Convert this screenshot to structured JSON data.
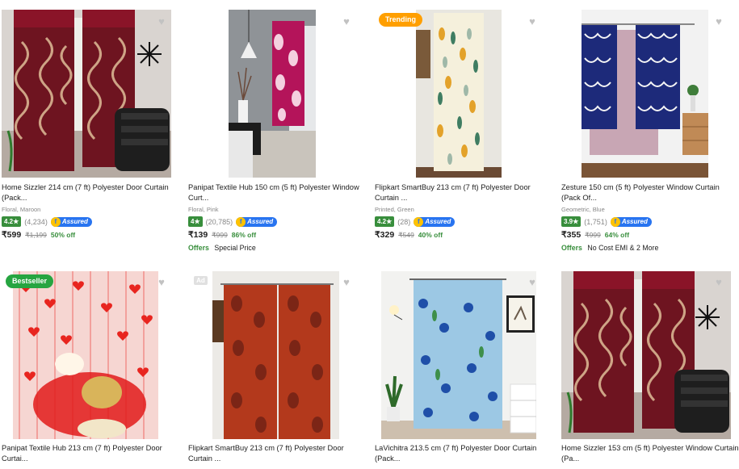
{
  "products": [
    {
      "title": "Home Sizzler 214 cm (7 ft) Polyester Door Curtain (Pack...",
      "subtitle": "Floral, Maroon",
      "rating": "4.2★",
      "reviews": "(4,234)",
      "assured": "Assured",
      "price": "₹599",
      "mrp": "₹1,199",
      "discount": "50% off",
      "offers_label": "",
      "offers_text": ""
    },
    {
      "title": "Panipat Textile Hub 150 cm (5 ft) Polyester Window Curt...",
      "subtitle": "Floral, Pink",
      "rating": "4★",
      "reviews": "(20,785)",
      "assured": "Assured",
      "price": "₹139",
      "mrp": "₹999",
      "discount": "86% off",
      "offers_label": "Offers",
      "offers_text": "Special Price"
    },
    {
      "title": "Flipkart SmartBuy 213 cm (7 ft) Polyester Door Curtain ...",
      "subtitle": "Printed, Green",
      "rating": "4.2★",
      "reviews": "(28)",
      "assured": "Assured",
      "price": "₹329",
      "mrp": "₹549",
      "discount": "40% off",
      "offers_label": "",
      "offers_text": "",
      "tag": "Trending"
    },
    {
      "title": "Zesture 150 cm (5 ft) Polyester Window Curtain (Pack Of...",
      "subtitle": "Geometric, Blue",
      "rating": "3.9★",
      "reviews": "(1,751)",
      "assured": "Assured",
      "price": "₹355",
      "mrp": "₹999",
      "discount": "64% off",
      "offers_label": "Offers",
      "offers_text": "No Cost EMI & 2 More"
    },
    {
      "title": "Panipat Textile Hub 213 cm (7 ft) Polyester Door Curtai...",
      "tag": "Bestseller"
    },
    {
      "title": "Flipkart SmartBuy 213 cm (7 ft) Polyester Door Curtain ...",
      "ad": "Ad"
    },
    {
      "title": "LaVichitra 213.5 cm (7 ft) Polyester Door Curtain (Pack..."
    },
    {
      "title": "Home Sizzler 153 cm (5 ft) Polyester Window Curtain (Pa..."
    }
  ],
  "icons": {
    "wishlist": "heart-icon",
    "assured": "flipkart-assured-icon"
  },
  "colors": {
    "rating_green": "#388e3c",
    "discount_green": "#388e3c",
    "assured_blue": "#2874f0",
    "trending": "#ff9f00",
    "bestseller": "#26a541"
  }
}
